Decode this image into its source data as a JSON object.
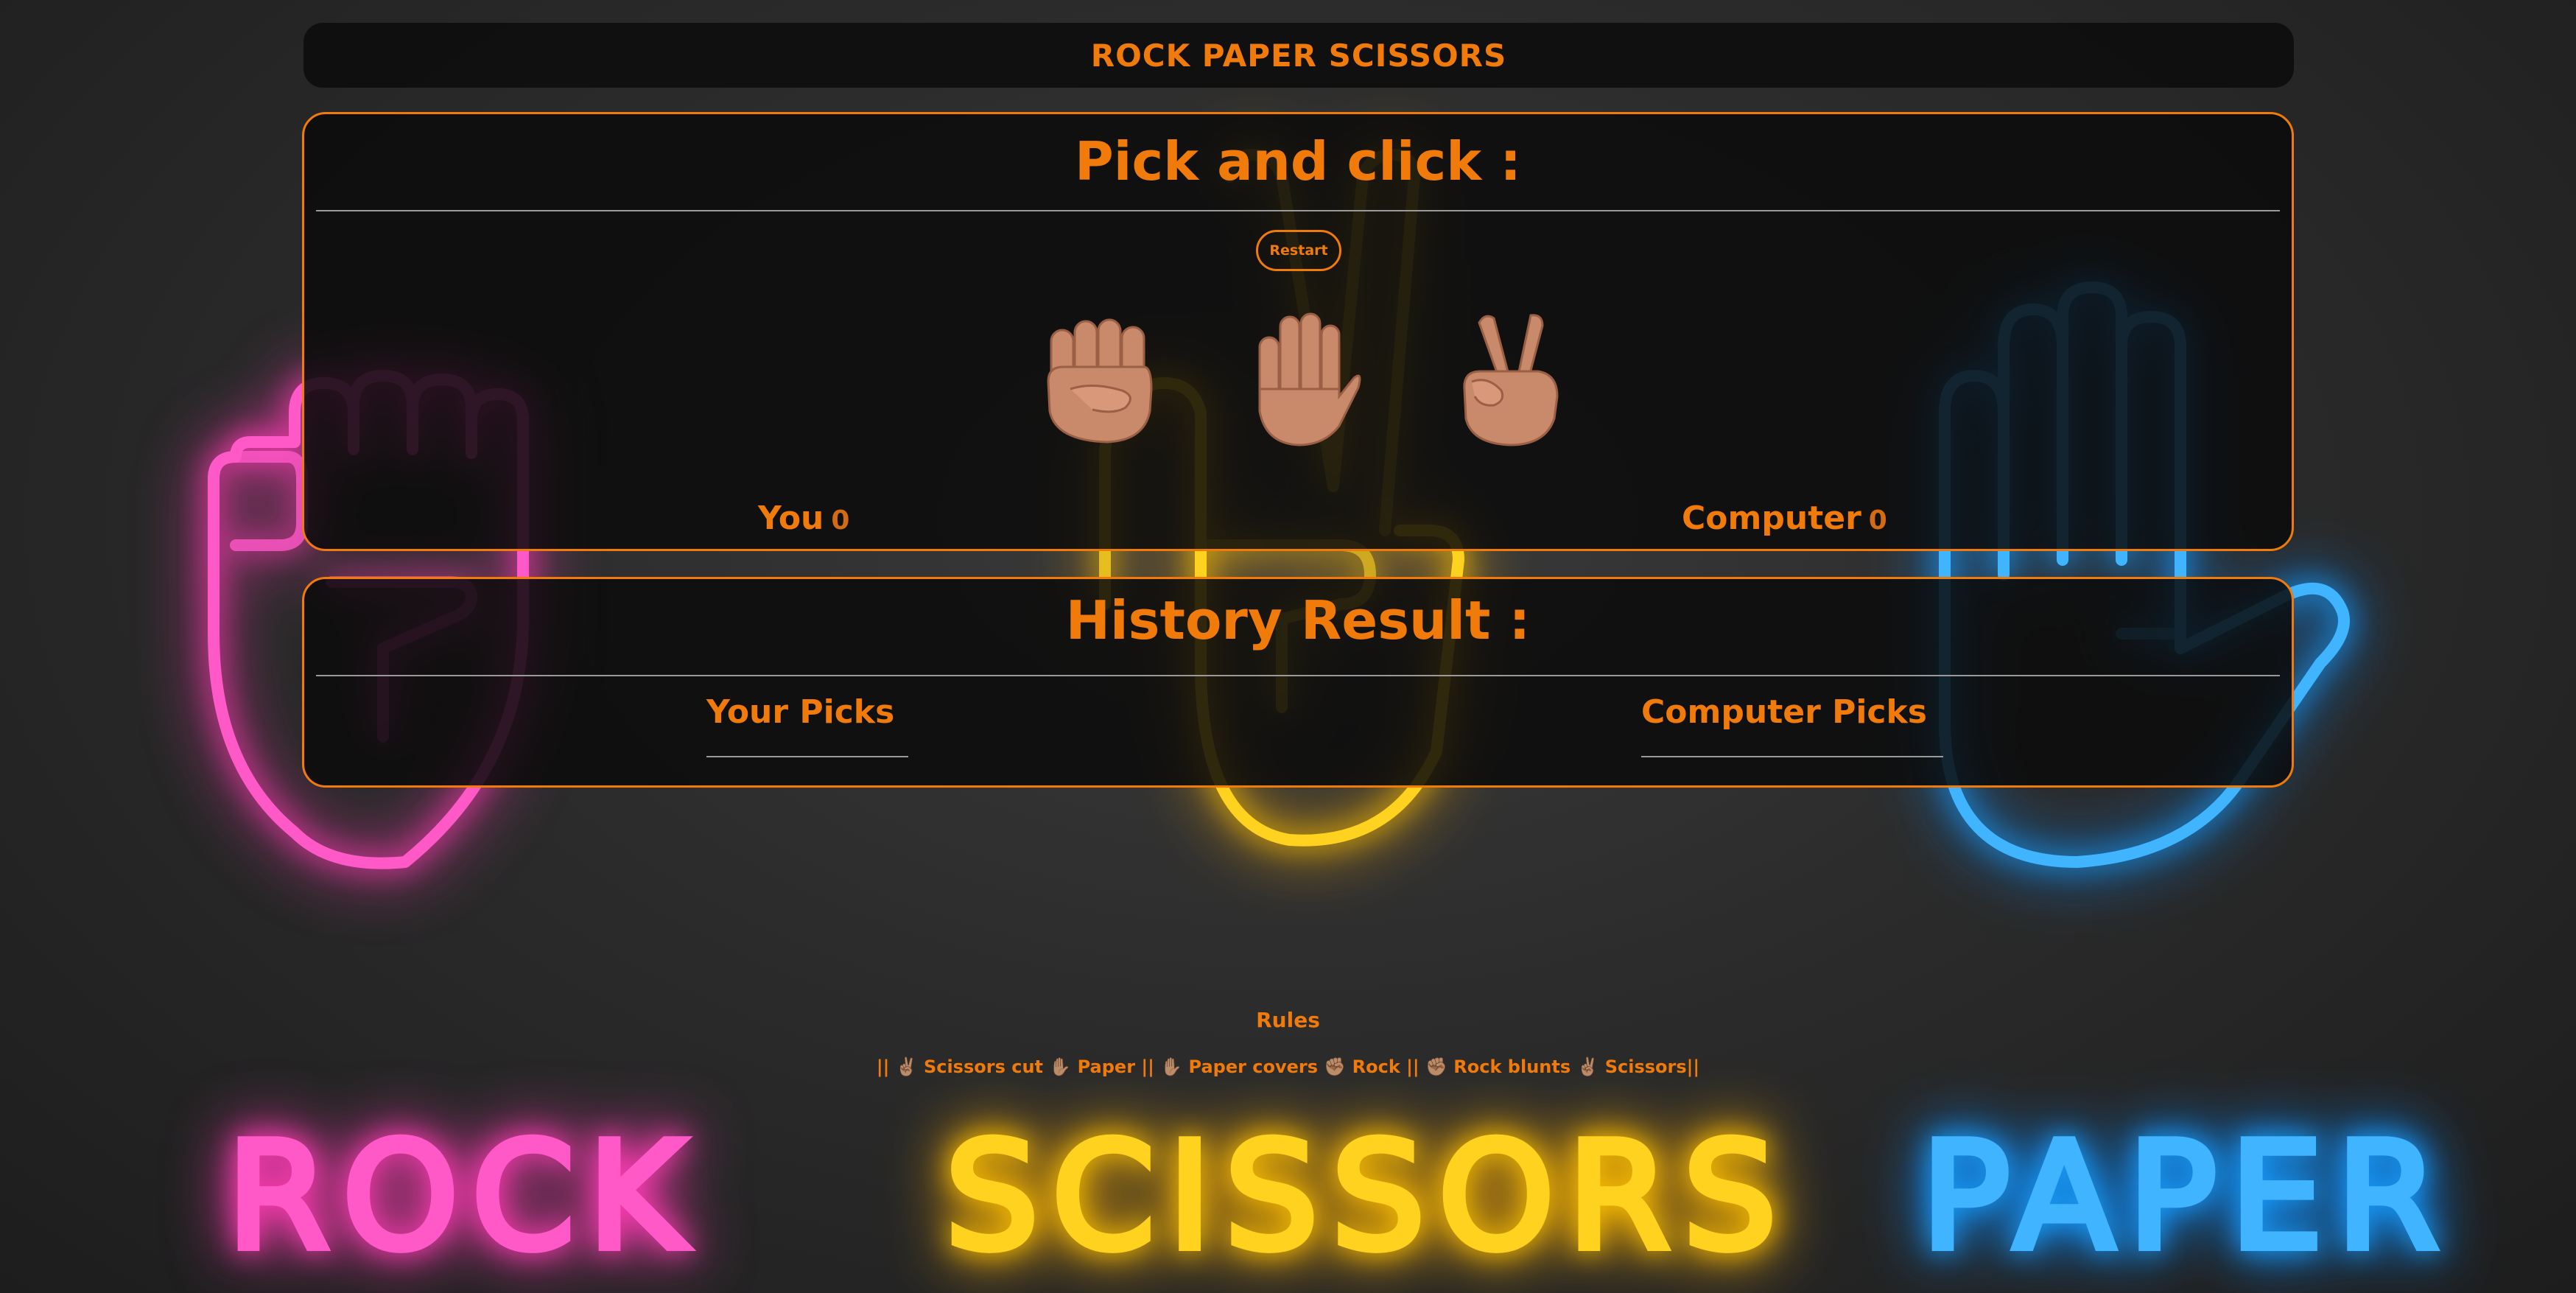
{
  "header": {
    "title": "ROCK PAPER SCISSORS"
  },
  "game": {
    "heading": "Pick and click :",
    "restart_label": "Restart",
    "choices": [
      {
        "name": "rock",
        "icon": "fist-icon"
      },
      {
        "name": "paper",
        "icon": "raised-hand-icon"
      },
      {
        "name": "scissors",
        "icon": "victory-hand-icon"
      }
    ],
    "player": {
      "label": "You",
      "score": "0"
    },
    "computer": {
      "label": "Computer",
      "score": "0"
    }
  },
  "history": {
    "heading": "History Result :",
    "your_picks_label": "Your Picks",
    "computer_picks_label": "Computer Picks"
  },
  "rules": {
    "title": "Rules",
    "text": "|| ✌🏽 Scissors cut ✋🏽 Paper || ✋🏽 Paper covers ✊🏽 Rock || ✊🏽 Rock blunts ✌🏽 Scissors||"
  },
  "background": {
    "words": [
      "ROCK",
      "SCISSORS",
      "PAPER"
    ],
    "colors": {
      "rock": "#ff59c8",
      "scissors": "#ffd21f",
      "paper": "#40b4ff",
      "accent": "#f07a0a"
    }
  }
}
